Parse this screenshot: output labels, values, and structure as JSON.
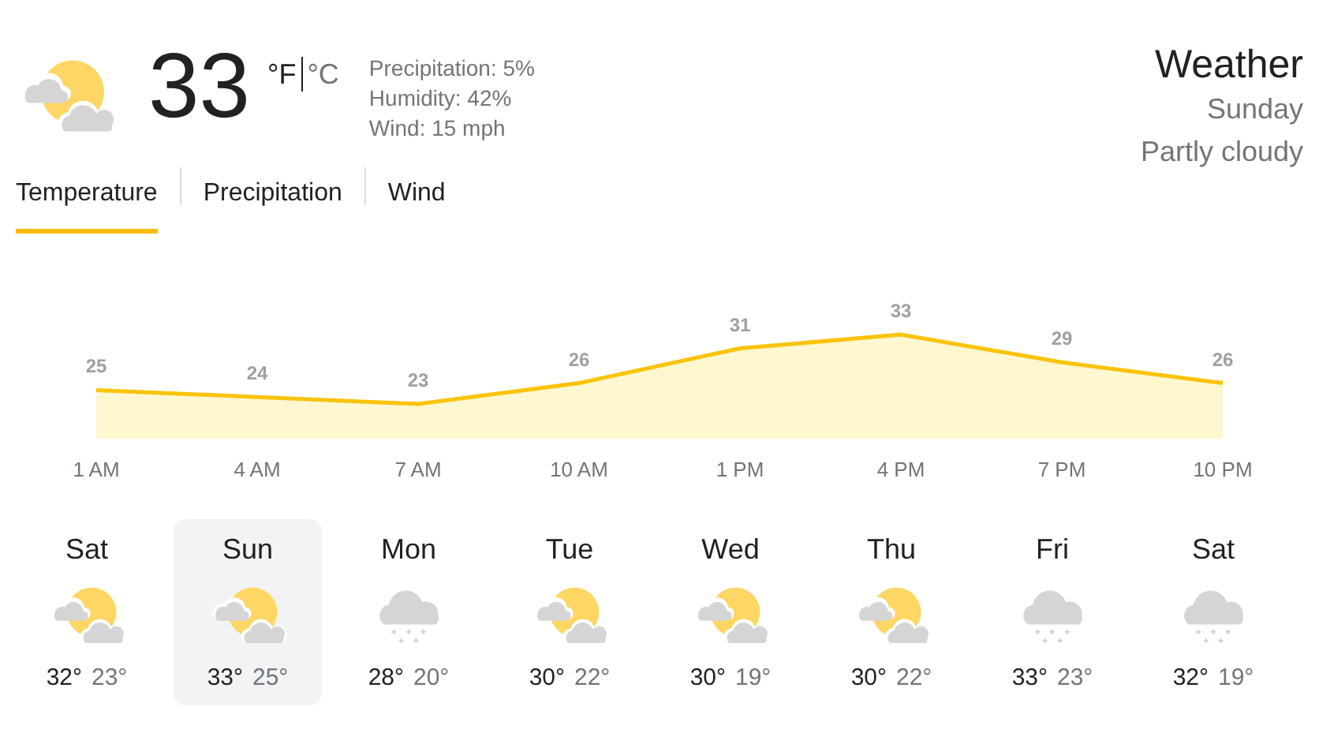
{
  "current": {
    "kind": "partly_cloudy",
    "temperature": "33",
    "units": [
      {
        "label": "°F",
        "selected": true
      },
      {
        "label": "°C",
        "selected": false
      }
    ],
    "details": [
      "Precipitation: 5%",
      "Humidity: 42%",
      "Wind: 15 mph"
    ]
  },
  "header": {
    "title": "Weather",
    "day": "Sunday",
    "condition": "Partly cloudy"
  },
  "tabs": [
    {
      "label": "Temperature",
      "selected": true
    },
    {
      "label": "Precipitation",
      "selected": false
    },
    {
      "label": "Wind",
      "selected": false
    }
  ],
  "chart_data": {
    "type": "area",
    "categories": [
      "1 AM",
      "4 AM",
      "7 AM",
      "10 AM",
      "1 PM",
      "4 PM",
      "7 PM",
      "10 PM"
    ],
    "values": [
      25,
      24,
      23,
      26,
      31,
      33,
      29,
      26
    ],
    "data_labels": true
  },
  "days": [
    {
      "day": "Sat",
      "kind": "partly_cloudy",
      "high": "32°",
      "low": "23°",
      "selected": false
    },
    {
      "day": "Sun",
      "kind": "partly_cloudy",
      "high": "33°",
      "low": "25°",
      "selected": true
    },
    {
      "day": "Mon",
      "kind": "snow",
      "high": "28°",
      "low": "20°",
      "selected": false
    },
    {
      "day": "Tue",
      "kind": "partly_cloudy",
      "high": "30°",
      "low": "22°",
      "selected": false
    },
    {
      "day": "Wed",
      "kind": "partly_cloudy",
      "high": "30°",
      "low": "19°",
      "selected": false
    },
    {
      "day": "Thu",
      "kind": "partly_cloudy",
      "high": "30°",
      "low": "22°",
      "selected": false
    },
    {
      "day": "Fri",
      "kind": "snow",
      "high": "33°",
      "low": "23°",
      "selected": false
    },
    {
      "day": "Sat",
      "kind": "snow",
      "high": "32°",
      "low": "19°",
      "selected": false
    }
  ]
}
